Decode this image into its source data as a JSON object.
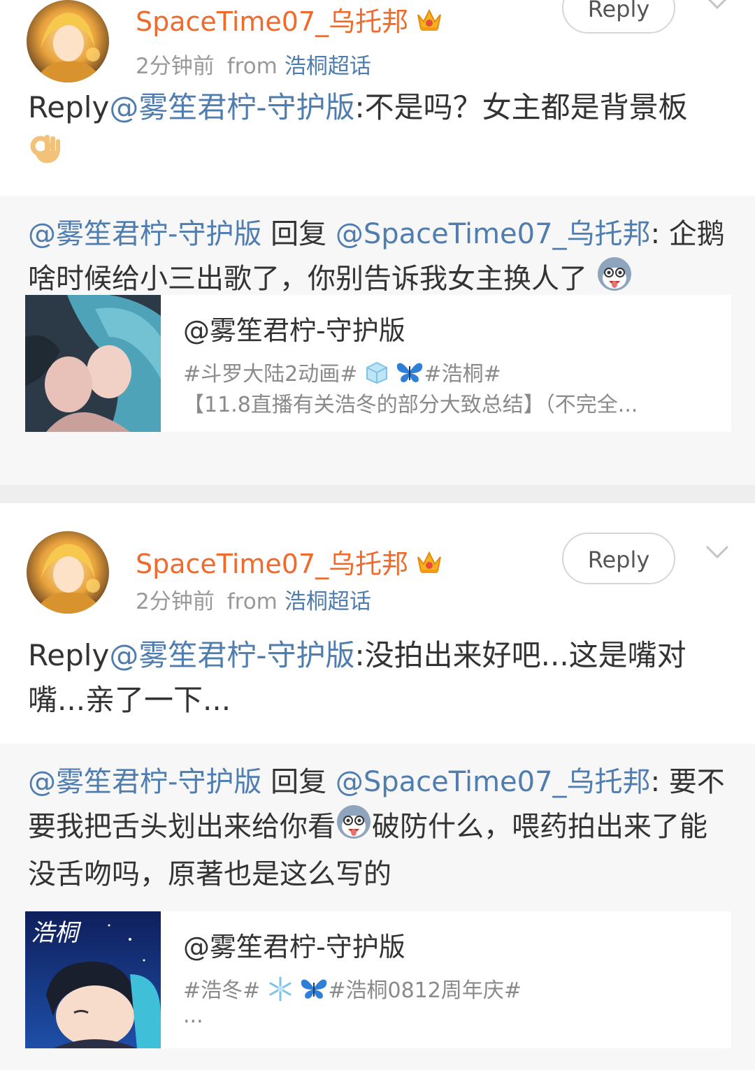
{
  "comments": [
    {
      "user": {
        "name": "SpaceTime07_乌托邦"
      },
      "meta": {
        "time": "2分钟前",
        "from_label": "from",
        "source": "浩桐超话"
      },
      "reply_button": "Reply",
      "body": {
        "prefix": "Reply",
        "mention": "@雾笙君柠-守护版",
        "text": ":不是吗？女主都是背景板"
      },
      "quote": {
        "mention": "@雾笙君柠-守护版",
        "verb": " 回复 ",
        "target": "@SpaceTime07_乌托邦",
        "text": ": 企鹅啥时候给小三出歌了，你别告诉我女主换人了"
      },
      "link_card": {
        "title": "@雾笙君柠-守护版",
        "tags_a": "#斗罗大陆2动画#",
        "tags_b": "#浩桐#",
        "desc": "【11.8直播有关浩冬的部分大致总结】（不完全..."
      }
    },
    {
      "user": {
        "name": "SpaceTime07_乌托邦"
      },
      "meta": {
        "time": "2分钟前",
        "from_label": "from",
        "source": "浩桐超话"
      },
      "reply_button": "Reply",
      "body": {
        "prefix": "Reply",
        "mention": "@雾笙君柠-守护版",
        "text": ":没拍出来好吧...这是嘴对嘴...亲了一下..."
      },
      "quote": {
        "mention": "@雾笙君柠-守护版",
        "verb": " 回复 ",
        "target": "@SpaceTime07_乌托邦",
        "text_a": ": 要不要我把舌头划出来给你看",
        "text_b": "破防什么，喂药拍出来了能没舌吻吗，原著也是这么写的"
      },
      "link_card": {
        "title": "@雾笙君柠-守护版",
        "tags_a": "#浩冬#",
        "tags_b": "#浩桐0812周年庆#",
        "desc": "...",
        "thumb_logo": "浩桐"
      }
    }
  ],
  "colors": {
    "username": "#f06a2c",
    "link": "#507daf",
    "meta": "#999999",
    "quote_bg": "#f7f7f7",
    "separator": "#eeeeef"
  },
  "icons": [
    "crown-badge-icon",
    "chevron-down-icon",
    "ok-hand-emoji",
    "husky-emoji",
    "ice-cube-emoji",
    "butterfly-emoji",
    "snowflake-emoji"
  ]
}
